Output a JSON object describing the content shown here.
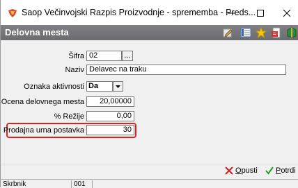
{
  "window": {
    "title": "Saop Večinvojski Razpis Proizvodnje - sprememba - Preds..."
  },
  "header": {
    "title": "Delovna mesta"
  },
  "form": {
    "sifra": {
      "label": "Šifra",
      "value": "02",
      "browse": "..."
    },
    "naziv": {
      "label": "Naziv",
      "value": "Delavec na traku"
    },
    "oznaka_aktivnosti": {
      "label": "Oznaka aktivnosti",
      "value": "Da"
    },
    "ocena": {
      "label": "Ocena delovnega mesta",
      "value": "20,00000"
    },
    "rezije": {
      "label": "% Režije",
      "value": "0,00"
    },
    "prodajna": {
      "label": "Prodajna urna postavka",
      "value": "30"
    }
  },
  "actions": {
    "cancel": {
      "underline": "O",
      "rest": "pusti"
    },
    "confirm": {
      "underline": "P",
      "rest": "otrdi"
    }
  },
  "status": {
    "label": "Skrbnik",
    "value": "001"
  },
  "colors": {
    "header_bg": "#78787c",
    "highlight": "#e02020",
    "cancel_icon": "#d02020",
    "confirm_icon": "#1e9e1e"
  }
}
